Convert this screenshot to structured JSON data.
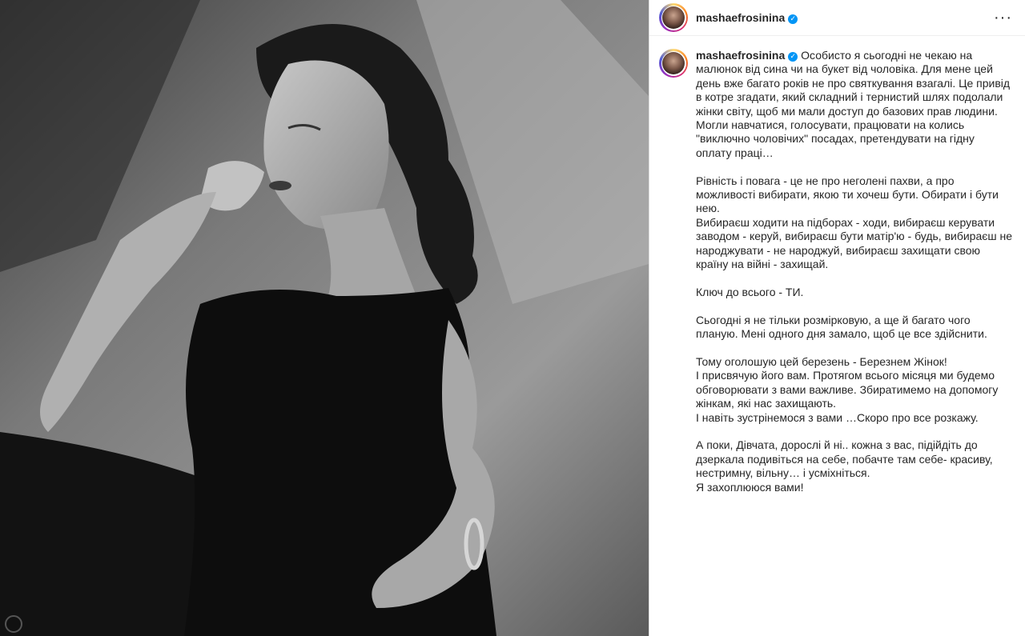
{
  "header": {
    "username": "mashaefrosinina",
    "verified_icon": "verified-badge-icon",
    "more_icon": "more-options-icon",
    "more_label": "···"
  },
  "caption": {
    "username": "mashaefrosinina",
    "text": "Особисто я сьогодні не чекаю на малюнок від сина чи на букет від чоловіка. Для мене цей день вже багато років не про святкування взагалі. Це привід в котре згадати, який складний і тернистий шлях подолали жінки світу, щоб ми мали доступ до базових прав людини. Могли навчатися, голосувати, працювати на колись \"виключно чоловічих\" посадах, претендувати на гідну оплату праці…\n\nРівність і повага - це не про неголені пахви, а про можливості вибирати, якою ти хочеш бути. Обирати і бути нею.\nВибираєш ходити на підборах - ходи, вибираєш керувати заводом - керуй, вибираєш бути матір'ю - будь, вибираєш не народжувати - не народжуй, вибираєш захищати свою країну на війні - захищай.\n\nКлюч до всього - ТИ.\n\nСьогодні я не тільки розмірковую, а ще й багато чого планую. Мені одного дня замало, щоб це все здійснити.\n\nТому оголошую цей березень - Березнем Жінок!\nІ присвячую його вам. Протягом всього місяця ми будемо обговорювати з вами важливе. Збиратимемо на допомогу жінкам, які нас захищають.\nІ навіть зустрінемося з вами …Скоро про все розкажу.\n\nА поки, Дівчата, дорослі й ні.. кожна з вас, підійдіть до дзеркала подивіться на себе, побачте там себе- красиву, нестримну, вільну… і усміхніться.\nЯ захоплююся вами!"
  },
  "photo": {
    "alt_icon": "photo-post-image",
    "style": "black-and-white portrait"
  }
}
